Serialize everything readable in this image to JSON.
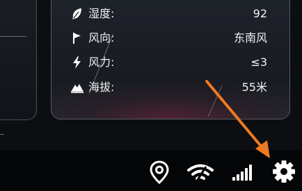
{
  "weather": {
    "rows": [
      {
        "icon": "leaf-icon",
        "label": "湿度:",
        "value": "92"
      },
      {
        "icon": "flag-icon",
        "label": "风向:",
        "value": "东南风"
      },
      {
        "icon": "lightning-icon",
        "label": "风力:",
        "value": "≤3"
      },
      {
        "icon": "mountain-icon",
        "label": "海拔:",
        "value": "55米"
      }
    ]
  },
  "statusbar": {
    "icons": [
      "location-pin-icon",
      "wifi-icon",
      "signal-bars-icon",
      "settings-gear-icon"
    ]
  },
  "colors": {
    "annotation_arrow": "#f07a22",
    "card_glow": "#8c1e3c",
    "background": "#050608"
  }
}
